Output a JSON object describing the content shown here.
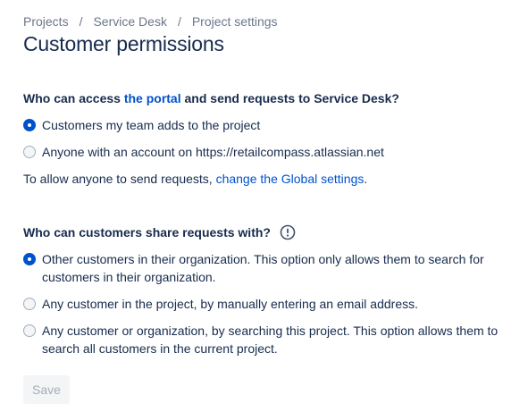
{
  "breadcrumb": {
    "items": [
      "Projects",
      "Service Desk",
      "Project settings"
    ],
    "separator": "/"
  },
  "page": {
    "title": "Customer permissions"
  },
  "access": {
    "heading_prefix": "Who can access ",
    "heading_link": "the portal",
    "heading_suffix": " and send requests to Service Desk?",
    "options": [
      {
        "label": "Customers my team adds to the project",
        "checked": true
      },
      {
        "label": "Anyone with an account on https://retailcompass.atlassian.net",
        "checked": false
      }
    ],
    "note_prefix": "To allow anyone to send requests, ",
    "note_link": "change the Global settings",
    "note_suffix": "."
  },
  "sharing": {
    "heading": "Who can customers share requests with?",
    "info_icon": "info-icon",
    "options": [
      {
        "label": "Other customers in their organization. This option only allows them to search for customers in their organization.",
        "checked": true
      },
      {
        "label": "Any customer in the project, by manually entering an email address.",
        "checked": false
      },
      {
        "label": "Any customer or organization, by searching this project. This option allows them to search all customers in the current project.",
        "checked": false
      }
    ]
  },
  "actions": {
    "save_label": "Save",
    "save_disabled": true
  },
  "colors": {
    "link": "#0052cc",
    "text": "#172b4d",
    "muted": "#6b778c",
    "radio_checked": "#0052cc"
  }
}
